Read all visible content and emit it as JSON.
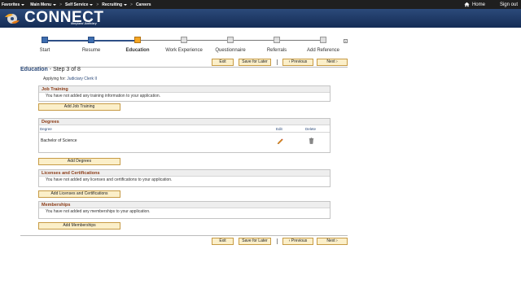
{
  "topnav": {
    "items": [
      {
        "label": "Favorites"
      },
      {
        "label": "Main Menu"
      },
      {
        "label": "Self Service"
      },
      {
        "label": "Recruiting"
      },
      {
        "label": "Careers"
      }
    ],
    "home_label": "Home",
    "signout_label": "Sign out"
  },
  "brand": {
    "name": "CONNECT",
    "tagline": "Maryland Judiciary",
    "colors": {
      "banner": "#1c3766",
      "accent": "#f5a623"
    }
  },
  "steps": [
    {
      "label": "Start",
      "state": "done"
    },
    {
      "label": "Resume",
      "state": "done"
    },
    {
      "label": "Education",
      "state": "current"
    },
    {
      "label": "Work Experience",
      "state": "todo"
    },
    {
      "label": "Questionnaire",
      "state": "todo"
    },
    {
      "label": "Referrals",
      "state": "todo"
    },
    {
      "label": "Add Reference",
      "state": "todo"
    }
  ],
  "nav_buttons": {
    "exit": "Exit",
    "save_later": "Save for Later",
    "previous": "Previous",
    "next": "Next"
  },
  "page": {
    "title": "Education",
    "step_text": "- Step 3 of 8",
    "applying_prefix": "Applying for:",
    "job_title": "Judiciary Clerk II"
  },
  "job_training": {
    "header": "Job Training",
    "message": "You have not added any training information to your application.",
    "add_label": "Add Job Training"
  },
  "degrees": {
    "header": "Degrees",
    "col_degree": "Degree",
    "col_edit": "Edit",
    "col_delete": "Delete",
    "rows": [
      {
        "degree": "Bachelor of Science"
      }
    ],
    "add_label": "Add Degrees"
  },
  "licenses": {
    "header": "Licenses and Certifications",
    "message": "You have not added any licenses and certifications to your application.",
    "add_label": "Add Licenses and Certifications"
  },
  "memberships": {
    "header": "Memberships",
    "message": "You have not added any memberships to your application.",
    "add_label": "Add Memberships"
  }
}
